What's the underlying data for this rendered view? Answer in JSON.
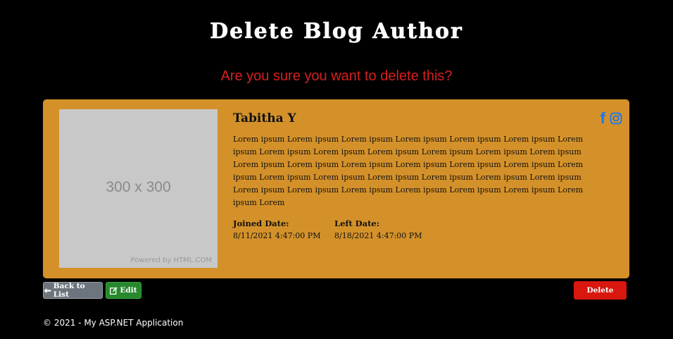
{
  "page": {
    "title": "Delete Blog Author",
    "confirm_message": "Are you sure you want to delete this?"
  },
  "author": {
    "image_placeholder_text": "300 x 300",
    "image_credit": "Powered by HTML.COM",
    "name": "Tabitha Y",
    "bio": "Lorem ipsum Lorem ipsum Lorem ipsum Lorem ipsum Lorem ipsum Lorem ipsum Lorem ipsum Lorem ipsum Lorem ipsum Lorem ipsum Lorem ipsum Lorem ipsum Lorem ipsum Lorem ipsum Lorem ipsum Lorem ipsum Lorem ipsum Lorem ipsum Lorem ipsum Lorem ipsum Lorem ipsum Lorem ipsum Lorem ipsum Lorem ipsum Lorem ipsum Lorem ipsum Lorem ipsum Lorem ipsum Lorem ipsum Lorem ipsum Lorem ipsum Lorem ipsum Lorem ipsum Lorem",
    "joined_label": "Joined Date:",
    "joined_value": "8/11/2021 4:47:00 PM",
    "left_label": "Left Date:",
    "left_value": "8/18/2021 4:47:00 PM",
    "social_icons": [
      "facebook-icon",
      "instagram-icon"
    ]
  },
  "actions": {
    "back_label": "Back to List",
    "edit_label": "Edit",
    "delete_label": "Delete"
  },
  "footer": {
    "text": "© 2021 - My ASP.NET Application"
  },
  "colors": {
    "background": "#000000",
    "card": "#d4912a",
    "confirm_text": "#d81f1f",
    "back_button": "#6c757d",
    "edit_button": "#28882e",
    "delete_button": "#d9170f",
    "facebook": "#1877f2"
  }
}
